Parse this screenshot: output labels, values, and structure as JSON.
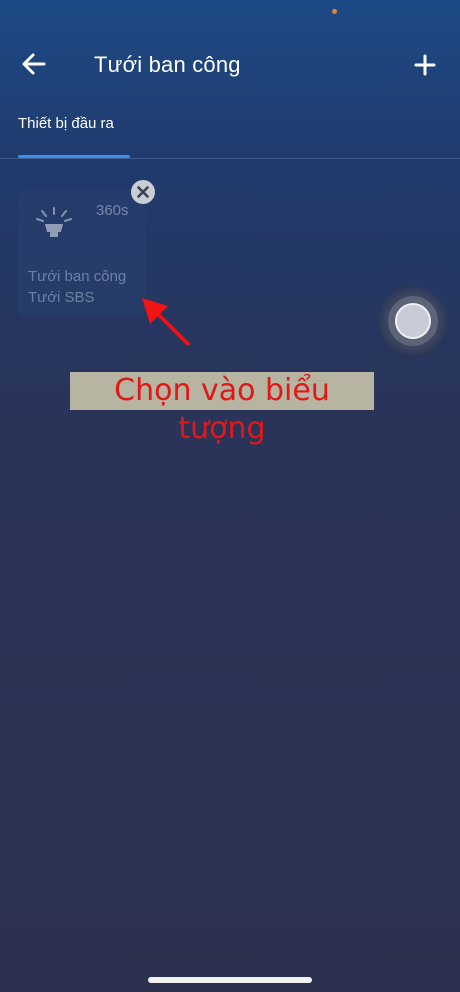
{
  "header": {
    "title": "Tưới ban công",
    "back_icon": "arrow-left-icon",
    "add_icon": "plus-icon"
  },
  "tabs": [
    {
      "label": "Thiết bị đầu ra",
      "active": true
    }
  ],
  "device_card": {
    "duration": "360s",
    "name": "Tưới ban công",
    "group": "Tưới SBS",
    "icon": "sprinkler-icon",
    "remove_icon": "close-icon"
  },
  "annotation": {
    "text": "Chọn vào biểu tượng",
    "text_color": "#e01818",
    "background": "#b8b4a2"
  },
  "colors": {
    "accent": "#3a8ee6",
    "background_top": "#1d4a86",
    "background_bottom": "#2d3150"
  }
}
